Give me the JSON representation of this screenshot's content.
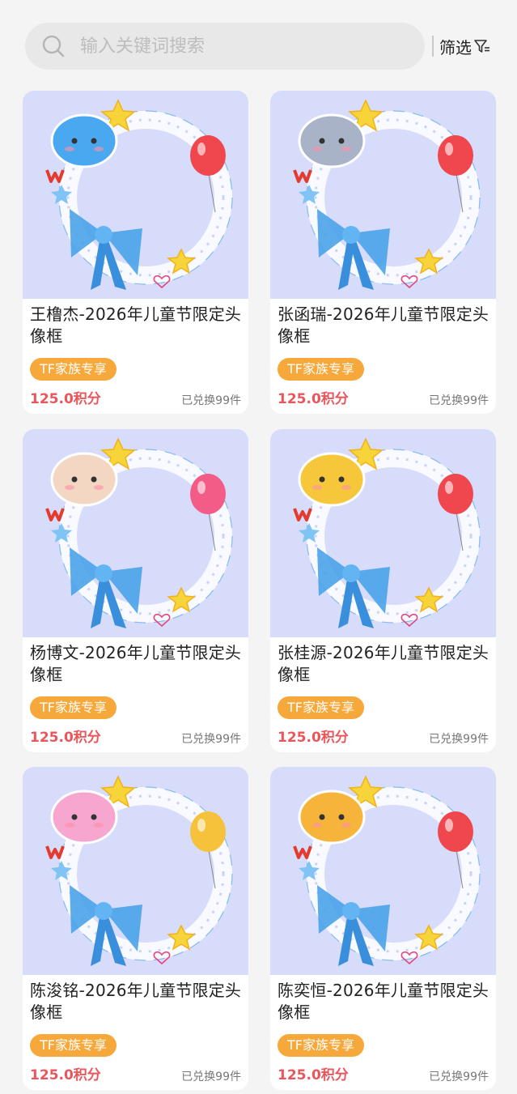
{
  "search": {
    "placeholder": "输入关键词搜索"
  },
  "filter": {
    "label": "筛选"
  },
  "colors": {
    "tag": "#f7a83b",
    "price": "#e9565c",
    "thumb_bg": "#d7dcfa"
  },
  "products": [
    {
      "title": "王橹杰-2026年儿童节限定头像框",
      "tag": "TF家族专享",
      "price": "125.0积分",
      "sold": "已兑换99件",
      "charm": "blue-cloud-balloon",
      "charm_color": "#4aa8f0",
      "balloon_color": "#f0474f"
    },
    {
      "title": "张函瑞-2026年儿童节限定头像框",
      "tag": "TF家族专享",
      "price": "125.0积分",
      "sold": "已兑换99件",
      "charm": "gray-cat-balloon",
      "charm_color": "#a9b3c8",
      "balloon_color": "#f0474f"
    },
    {
      "title": "杨博文-2026年儿童节限定头像框",
      "tag": "TF家族专享",
      "price": "125.0积分",
      "sold": "已兑换99件",
      "charm": "cream-sheep-balloon",
      "charm_color": "#f3d7c2",
      "balloon_color": "#f25c86"
    },
    {
      "title": "张桂源-2026年儿童节限定头像框",
      "tag": "TF家族专享",
      "price": "125.0积分",
      "sold": "已兑换99件",
      "charm": "yellow-dog-balloon",
      "charm_color": "#f6c63b",
      "balloon_color": "#f0474f"
    },
    {
      "title": "陈浚铭-2026年儿童节限定头像框",
      "tag": "TF家族专享",
      "price": "125.0积分",
      "sold": "已兑换99件",
      "charm": "pink-pig-balloon",
      "charm_color": "#f6a6cf",
      "balloon_color": "#f6c23b"
    },
    {
      "title": "陈奕恒-2026年儿童节限定头像框",
      "tag": "TF家族专享",
      "price": "125.0积分",
      "sold": "已兑换99件",
      "charm": "orange-puppy-balloon",
      "charm_color": "#f6b43b",
      "balloon_color": "#f0474f"
    }
  ]
}
